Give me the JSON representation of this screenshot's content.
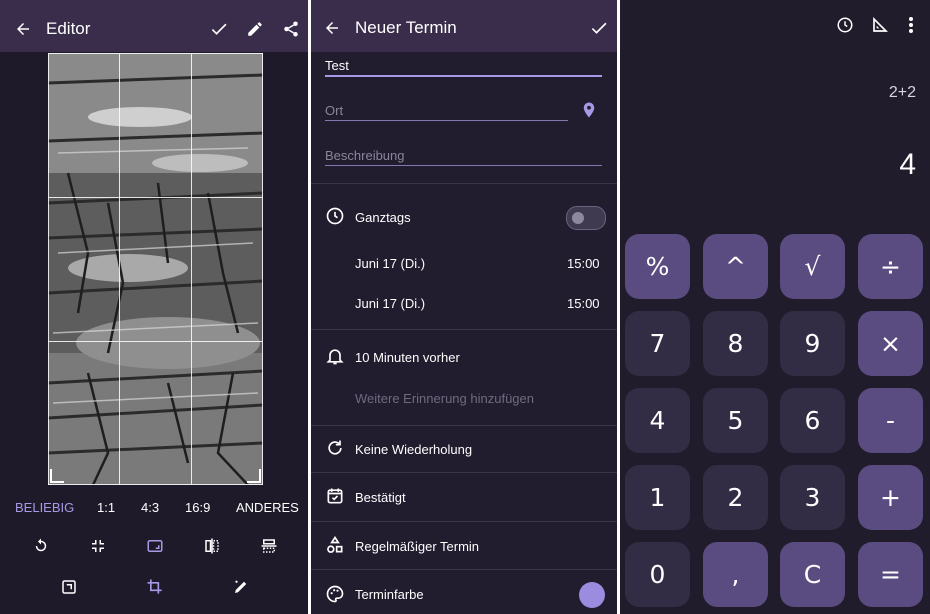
{
  "editor": {
    "title": "Editor",
    "ratios": [
      "BELIEBIG",
      "1:1",
      "4:3",
      "16:9",
      "ANDERES"
    ],
    "active_ratio": "BELIEBIG"
  },
  "event": {
    "title": "Neuer Termin",
    "title_value": "Test",
    "location_placeholder": "Ort",
    "description_placeholder": "Beschreibung",
    "all_day_label": "Ganztags",
    "all_day_on": false,
    "start_date": "Juni 17 (Di.)",
    "start_time": "15:00",
    "end_date": "Juni 17 (Di.)",
    "end_time": "15:00",
    "reminder": "10 Minuten vorher",
    "add_reminder": "Weitere Erinnerung hinzufügen",
    "repeat": "Keine Wiederholung",
    "status": "Bestätigt",
    "type": "Regelmäßiger Termin",
    "color_label": "Terminfarbe",
    "color_value": "#9b8ce0"
  },
  "calculator": {
    "expression": "2+2",
    "result": "4",
    "keys": [
      "%",
      "^",
      "√",
      "÷",
      "7",
      "8",
      "9",
      "×",
      "4",
      "5",
      "6",
      "-",
      "1",
      "2",
      "3",
      "+",
      "0",
      ",",
      "C",
      "="
    ]
  },
  "colors": {
    "accent": "#a899e6",
    "appbar": "#3a2d4c",
    "key_dark": "#332c45",
    "key_accent": "#5a4c80"
  }
}
